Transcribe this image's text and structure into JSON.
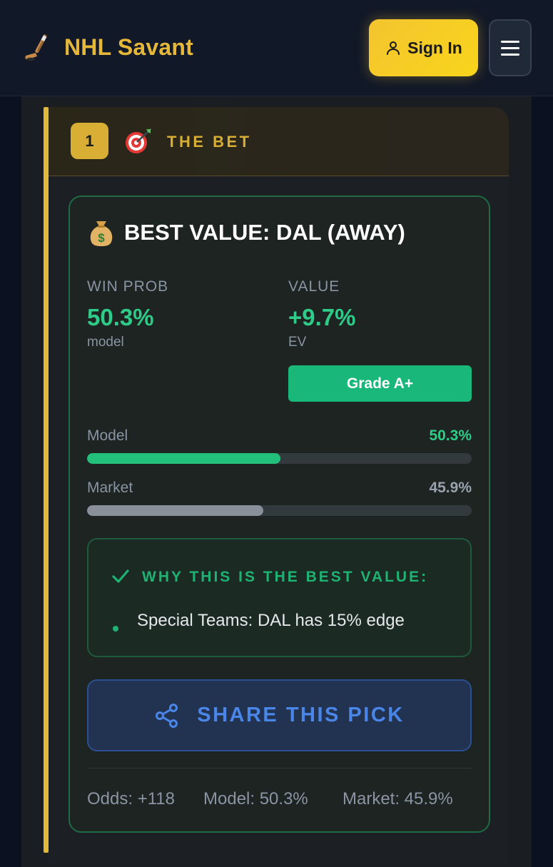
{
  "header": {
    "app_name": "NHL Savant",
    "logo_icon": "hockey-stick-icon",
    "signin_label": "Sign In",
    "signin_icon": "user-icon",
    "menu_icon": "hamburger-menu-icon"
  },
  "bet_section": {
    "step_number": "1",
    "title": "THE BET",
    "icon": "dart-target-icon"
  },
  "card": {
    "title": "BEST VALUE: DAL (AWAY)",
    "title_icon": "money-bag-icon",
    "win_prob": {
      "label": "WIN PROB",
      "value": "50.3%",
      "sub": "model"
    },
    "value": {
      "label": "VALUE",
      "value": "+9.7%",
      "sub": "EV"
    },
    "grade": "Grade A+",
    "bars": [
      {
        "label": "Model",
        "value_text": "50.3%",
        "percent": 50.3,
        "color": "#22c07a",
        "text_color": "#2ecc88"
      },
      {
        "label": "Market",
        "value_text": "45.9%",
        "percent": 45.9,
        "color": "#8a9099",
        "text_color": "#9aa3ad"
      }
    ],
    "why": {
      "title": "WHY THIS IS THE BEST VALUE:",
      "icon": "checkmark-icon",
      "reasons": [
        "Special Teams: DAL has 15% edge"
      ]
    },
    "share": {
      "label": "SHARE THIS PICK",
      "icon": "share-icon"
    },
    "footer": {
      "odds": "Odds: +118",
      "model": "Model: 50.3%",
      "market": "Market: 45.9%"
    }
  },
  "colors": {
    "gold": "#e6b83a",
    "green": "#2ecc88",
    "blue": "#4a86e8"
  }
}
